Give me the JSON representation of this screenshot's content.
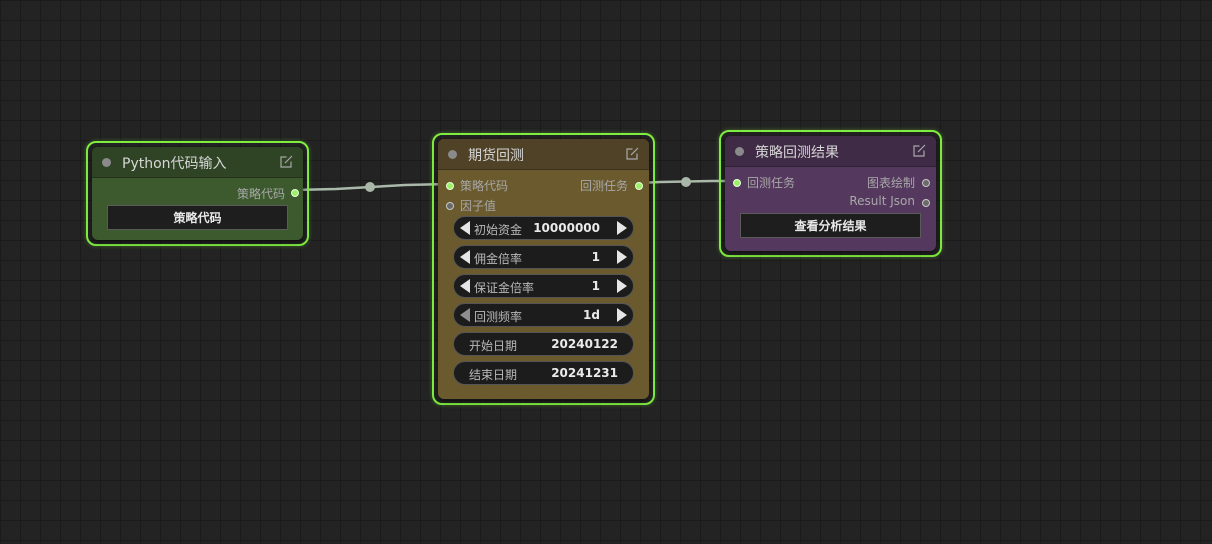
{
  "nodes": {
    "python_input": {
      "title": "Python代码输入",
      "outputs": [
        "策略代码"
      ],
      "button_label": "策略代码",
      "color": "#3d5a2e"
    },
    "futures_backtest": {
      "title": "期货回测",
      "inputs": [
        "策略代码",
        "因子值"
      ],
      "outputs": [
        "回测任务"
      ],
      "widgets": [
        {
          "label": "初始资金",
          "value": "10000000"
        },
        {
          "label": "佣金倍率",
          "value": "1"
        },
        {
          "label": "保证金倍率",
          "value": "1"
        },
        {
          "label": "回测频率",
          "value": "1d"
        },
        {
          "label": "开始日期",
          "value": "20240122"
        },
        {
          "label": "结束日期",
          "value": "20241231"
        }
      ],
      "color": "#6a5a2e"
    },
    "backtest_result": {
      "title": "策略回测结果",
      "inputs": [
        "回测任务"
      ],
      "outputs": [
        "图表绘制",
        "Result Json"
      ],
      "button_label": "查看分析结果",
      "color": "#55385e"
    }
  },
  "colors": {
    "selection_outline": "#80ee40",
    "link": "#a9b8a9",
    "canvas": "#232323"
  }
}
